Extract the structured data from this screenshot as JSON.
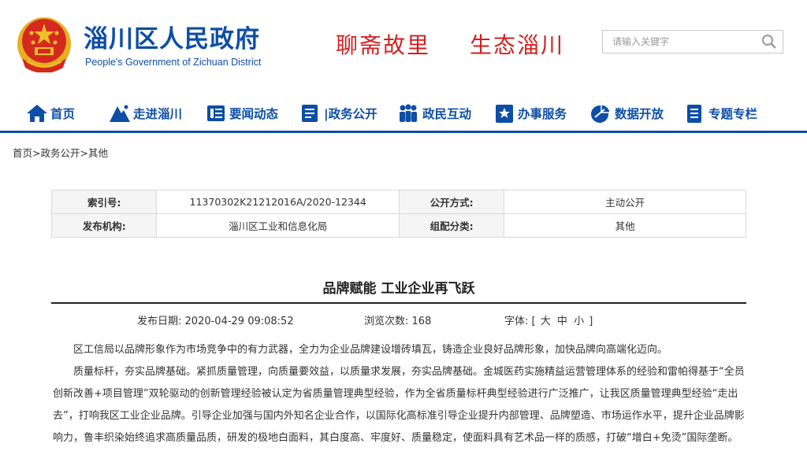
{
  "header": {
    "site_title": "淄川区人民政府",
    "site_subtitle": "People's Government of Zichuan District",
    "slogan_1": "聊斋故里",
    "slogan_2": "生态淄川",
    "search_placeholder": "请输入关键字",
    "emblem_icon": "national-emblem-icon",
    "search_icon": "search-icon"
  },
  "nav": {
    "items": [
      {
        "label": "首页",
        "icon": "home-icon"
      },
      {
        "label": "走进淄川",
        "icon": "mountain-icon"
      },
      {
        "label": "要闻动态",
        "icon": "news-icon"
      },
      {
        "label": "|政务公开",
        "icon": "document-icon"
      },
      {
        "label": "政民互动",
        "icon": "people-icon"
      },
      {
        "label": "办事服务",
        "icon": "star-bookmark-icon"
      },
      {
        "label": "数据开放",
        "icon": "pie-chart-icon"
      },
      {
        "label": "专题专栏",
        "icon": "list-doc-icon"
      }
    ]
  },
  "breadcrumb": {
    "items": [
      "首页",
      "政务公开",
      "其他"
    ],
    "separator": ">"
  },
  "info": {
    "index_label": "索引号:",
    "index_value": "11370302K21212016A/2020-12344",
    "open_label": "公开方式:",
    "open_value": "主动公开",
    "org_label": "发布机构:",
    "org_value": "淄川区工业和信息化局",
    "category_label": "组配分类:",
    "category_value": "其他"
  },
  "article": {
    "title": "品牌赋能 工业企业再飞跃",
    "date_label": "发布日期:",
    "date_value": "2020-04-29 09:08:52",
    "views_label": "浏览次数:",
    "views_value": "168",
    "font_label": "字体:",
    "font_open": "[",
    "font_large": "大",
    "font_medium": "中",
    "font_small": "小",
    "font_close": "]",
    "paragraphs": [
      "区工信局以品牌形象作为市场竞争中的有力武器，全力为企业品牌建设增砖填瓦，铸造企业良好品牌形象，加快品牌向高端化迈向。",
      "质量标杆，夯实品牌基础。紧抓质量管理，向质量要效益，以质量求发展，夯实品牌基础。金城医药实施精益运营管理体系的经验和雷帕得基于“全员创新改善+项目管理”双轮驱动的创新管理经验被认定为省质量管理典型经验，作为全省质量标杆典型经验进行广泛推广，让我区质量管理典型经验“走出去”，打响我区工业企业品牌。引导企业加强与国内外知名企业合作，以国际化高标准引导企业提升内部管理、品牌塑造、市场运作水平，提升企业品牌影响力，鲁丰织染始终追求高质量品质，研发的极地白面料，其白度高、牢度好、质量稳定，使面料具有艺术品一样的质感，打破“增白+免烫”国际垄断。"
    ]
  },
  "colors": {
    "brand_blue": "#0d4ea6",
    "slogan_red": "#d21f1f"
  }
}
